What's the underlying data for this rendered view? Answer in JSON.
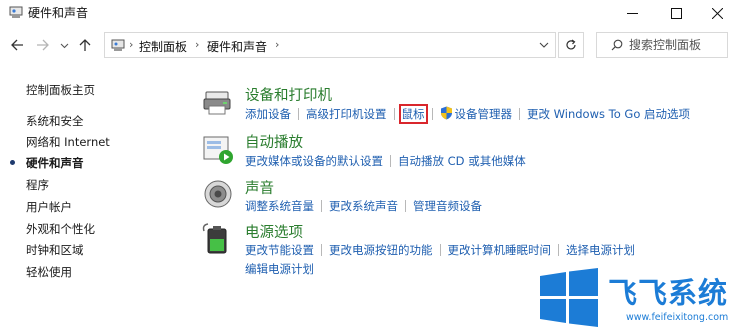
{
  "window": {
    "title": "硬件和声音"
  },
  "breadcrumb": {
    "items": [
      "控制面板",
      "硬件和声音"
    ]
  },
  "search": {
    "placeholder": "搜索控制面板"
  },
  "sidebar": {
    "home": "控制面板主页",
    "items": [
      "系统和安全",
      "网络和 Internet",
      "硬件和声音",
      "程序",
      "用户帐户",
      "外观和个性化",
      "时钟和区域",
      "轻松使用"
    ],
    "current_index": 2
  },
  "categories": [
    {
      "title": "设备和打印机",
      "icon": "devices-printers-icon",
      "links": [
        [
          "添加设备",
          "高级打印机设置",
          "鼠标",
          "设备管理器",
          "更改 Windows To Go 启动选项"
        ]
      ],
      "highlighted_link": "鼠标",
      "shield_link": "设备管理器"
    },
    {
      "title": "自动播放",
      "icon": "autoplay-icon",
      "links": [
        [
          "更改媒体或设备的默认设置",
          "自动播放 CD 或其他媒体"
        ]
      ]
    },
    {
      "title": "声音",
      "icon": "speaker-icon",
      "links": [
        [
          "调整系统音量",
          "更改系统声音",
          "管理音频设备"
        ]
      ]
    },
    {
      "title": "电源选项",
      "icon": "battery-power-icon",
      "links": [
        [
          "更改节能设置",
          "更改电源按钮的功能",
          "更改计算机睡眠时间",
          "选择电源计划"
        ],
        [
          "编辑电源计划"
        ]
      ]
    }
  ],
  "watermark": {
    "title": "飞飞系统",
    "url": "www.feifeixitong.com"
  },
  "colors": {
    "link": "#1f5fb0",
    "category_title": "#2a7d2e",
    "highlight_box": "#d9262c",
    "watermark": "#1c7cd6"
  }
}
